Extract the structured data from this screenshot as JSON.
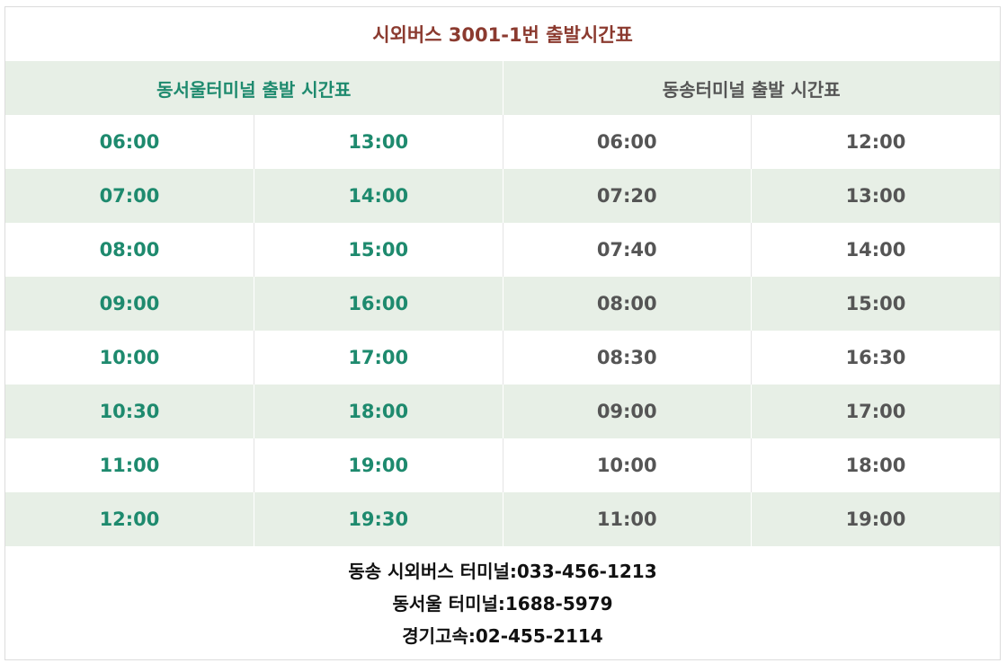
{
  "title": "시외버스 3001-1번 출발시간표",
  "headers": {
    "left": "동서울터미널 출발 시간표",
    "right": "동송터미널 출발 시간표"
  },
  "rows": [
    [
      "06:00",
      "13:00",
      "06:00",
      "12:00"
    ],
    [
      "07:00",
      "14:00",
      "07:20",
      "13:00"
    ],
    [
      "08:00",
      "15:00",
      "07:40",
      "14:00"
    ],
    [
      "09:00",
      "16:00",
      "08:00",
      "15:00"
    ],
    [
      "10:00",
      "17:00",
      "08:30",
      "16:30"
    ],
    [
      "10:30",
      "18:00",
      "09:00",
      "17:00"
    ],
    [
      "11:00",
      "19:00",
      "10:00",
      "18:00"
    ],
    [
      "12:00",
      "19:30",
      "11:00",
      "19:00"
    ]
  ],
  "contacts": [
    "동송 시외버스 터미널:033-456-1213",
    "동서울 터미널:1688-5979",
    "경기고속:02-455-2114"
  ],
  "colors": {
    "title": "#8b3a2f",
    "accent_green": "#1e8a6e",
    "gray_text": "#555555",
    "stripe": "#e7efe6"
  }
}
